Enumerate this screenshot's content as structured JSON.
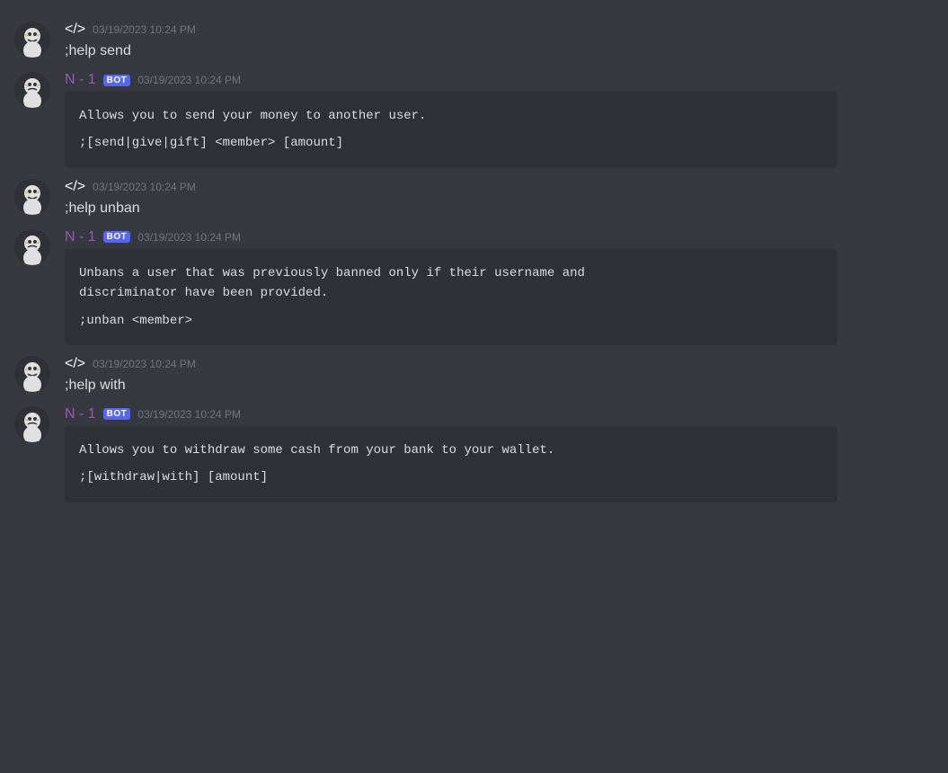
{
  "messages": [
    {
      "id": "msg1",
      "type": "user",
      "username": "</>",
      "timestamp": "03/19/2023 10:24 PM",
      "text": ";help send",
      "embed": null
    },
    {
      "id": "msg2",
      "type": "bot",
      "username": "N - 1",
      "badge": "BOT",
      "timestamp": "03/19/2023 10:24 PM",
      "text": null,
      "embed": {
        "line1": "Allows you to send your money to another user.",
        "line2": ";[send|give|gift] <member> [amount]"
      }
    },
    {
      "id": "msg3",
      "type": "user",
      "username": "</>",
      "timestamp": "03/19/2023 10:24 PM",
      "text": ";help unban",
      "embed": null
    },
    {
      "id": "msg4",
      "type": "bot",
      "username": "N - 1",
      "badge": "BOT",
      "timestamp": "03/19/2023 10:24 PM",
      "text": null,
      "embed": {
        "line1": "Unbans a user that was previously banned only if their username and\ndiscriminator have been provided.",
        "line2": ";unban <member>"
      }
    },
    {
      "id": "msg5",
      "type": "user",
      "username": "</>",
      "timestamp": "03/19/2023 10:24 PM",
      "text": ";help with",
      "embed": null
    },
    {
      "id": "msg6",
      "type": "bot",
      "username": "N - 1",
      "badge": "BOT",
      "timestamp": "03/19/2023 10:24 PM",
      "text": null,
      "embed": {
        "line1": "Allows you to withdraw some cash from your bank to your wallet.",
        "line2": ";[withdraw|with] [amount]"
      }
    }
  ],
  "labels": {
    "bot_badge": "BOT"
  }
}
